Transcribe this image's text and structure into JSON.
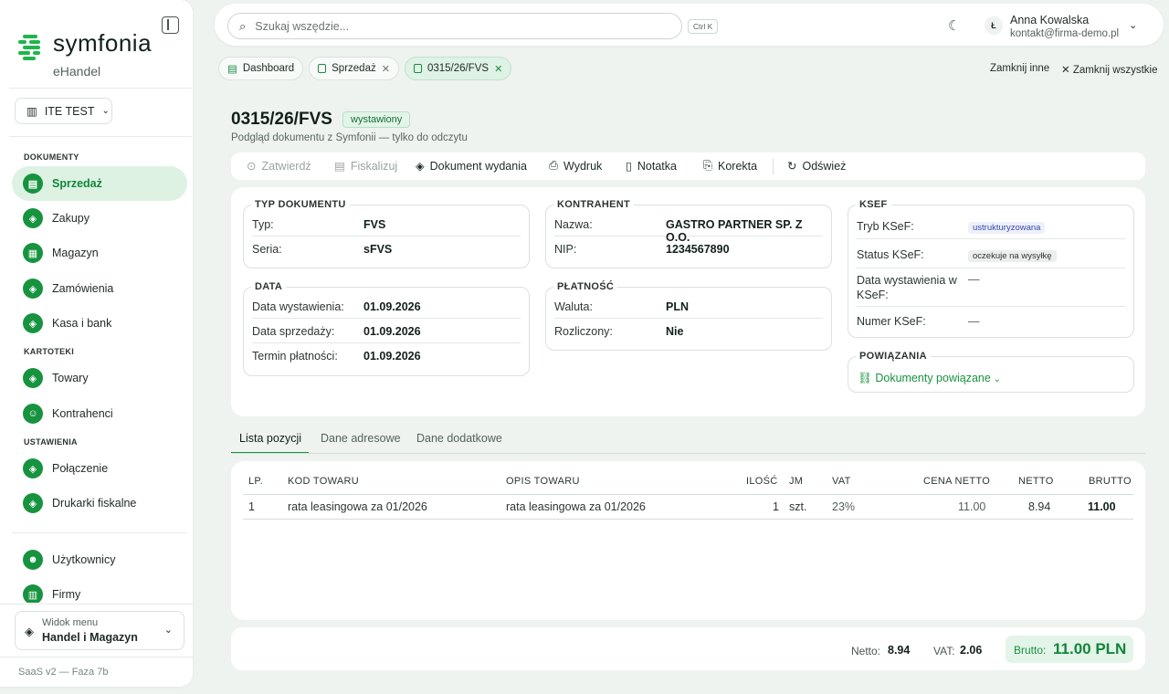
{
  "app": {
    "logo_text": "symfonia",
    "logo_sub": "eHandel",
    "version": "SaaS v2 — Faza 7b"
  },
  "company": {
    "name": "ITE TEST"
  },
  "nav": {
    "sections": {
      "documents": "DOKUMENTY",
      "files": "KARTOTEKI",
      "settings": "USTAWIENIA"
    },
    "items": [
      {
        "label": "Sprzedaż",
        "active": true
      },
      {
        "label": "Zakupy"
      },
      {
        "label": "Magazyn"
      },
      {
        "label": "Zamówienia"
      },
      {
        "label": "Kasa i bank"
      },
      {
        "label": "Towary"
      },
      {
        "label": "Kontrahenci"
      },
      {
        "label": "Połączenie"
      },
      {
        "label": "Drukarki fiskalne"
      },
      {
        "label": "Użytkownicy"
      },
      {
        "label": "Firmy"
      }
    ],
    "menu_view": {
      "label": "Widok menu",
      "value": "Handel i Magazyn"
    }
  },
  "topbar": {
    "search_placeholder": "Szukaj wszędzie...",
    "shortcut": "Ctrl K",
    "user_initial": "Ł",
    "user_name": "Anna Kowalska",
    "user_email": "kontakt@firma-demo.pl"
  },
  "tabs": [
    {
      "label": "Dashboard"
    },
    {
      "label": "Sprzedaż"
    },
    {
      "label": "0315/26/FVS",
      "active": true
    }
  ],
  "tab_actions": {
    "close_others": "Zamknij inne",
    "close_all": "Zamknij wszystkie"
  },
  "document": {
    "number": "0315/26/FVS",
    "status": "wystawiony",
    "subtitle": "Podgląd dokumentu z Symfonii — tylko do odczytu"
  },
  "toolbar": {
    "approve": "Zatwierdź",
    "fiscalize": "Fiskalizuj",
    "release_doc": "Dokument wydania",
    "print": "Wydruk",
    "note": "Notatka",
    "correction": "Korekta",
    "refresh": "Odśwież"
  },
  "doc_type": {
    "legend": "TYP DOKUMENTU",
    "type_label": "Typ:",
    "type_value": "FVS",
    "series_label": "Seria:",
    "series_value": "sFVS"
  },
  "dates": {
    "legend": "DATA",
    "issue_label": "Data wystawienia:",
    "issue_value": "01.09.2026",
    "sale_label": "Data sprzedaży:",
    "sale_value": "01.09.2026",
    "due_label": "Termin płatności:",
    "due_value": "01.09.2026"
  },
  "contractor": {
    "legend": "KONTRAHENT",
    "name_label": "Nazwa:",
    "name_value": "GASTRO PARTNER SP. Z O.O.",
    "nip_label": "NIP:",
    "nip_value": "1234567890"
  },
  "payment": {
    "legend": "PŁATNOŚĆ",
    "currency_label": "Waluta:",
    "currency_value": "PLN",
    "settled_label": "Rozliczony:",
    "settled_value": "Nie"
  },
  "ksef": {
    "legend": "KSEF",
    "mode_label": "Tryb KSeF:",
    "mode_value": "ustrukturyzowana",
    "status_label": "Status KSeF:",
    "status_value": "oczekuje na wysyłkę",
    "date_label": "Data wystawienia w KSeF:",
    "date_value": "—",
    "number_label": "Numer KSeF:",
    "number_value": "—"
  },
  "relations": {
    "legend": "POWIĄZANIA",
    "link": "Dokumenty powiązane"
  },
  "subtabs": [
    "Lista pozycji",
    "Dane adresowe",
    "Dane dodatkowe"
  ],
  "items_table": {
    "headers": {
      "lp": "LP.",
      "code": "KOD TOWARU",
      "desc": "OPIS TOWARU",
      "qty": "ILOŚĆ",
      "unit": "JM",
      "vat": "VAT",
      "net_price": "CENA NETTO",
      "net": "NETTO",
      "gross": "BRUTTO"
    },
    "rows": [
      {
        "lp": "1",
        "code": "rata leasingowa za 01/2026",
        "desc": "rata leasingowa za 01/2026",
        "qty": "1",
        "unit": "szt.",
        "vat": "23%",
        "net_price": "11.00",
        "net": "8.94",
        "gross": "11.00"
      }
    ]
  },
  "totals": {
    "net_label": "Netto:",
    "net_value": "8.94",
    "vat_label": "VAT:",
    "vat_value": "2.06",
    "gross_label": "Brutto:",
    "gross_value": "11.00 PLN"
  },
  "colors": {
    "accent": "#17933f",
    "accent_light": "#def2e3",
    "background": "#eef3ef"
  }
}
